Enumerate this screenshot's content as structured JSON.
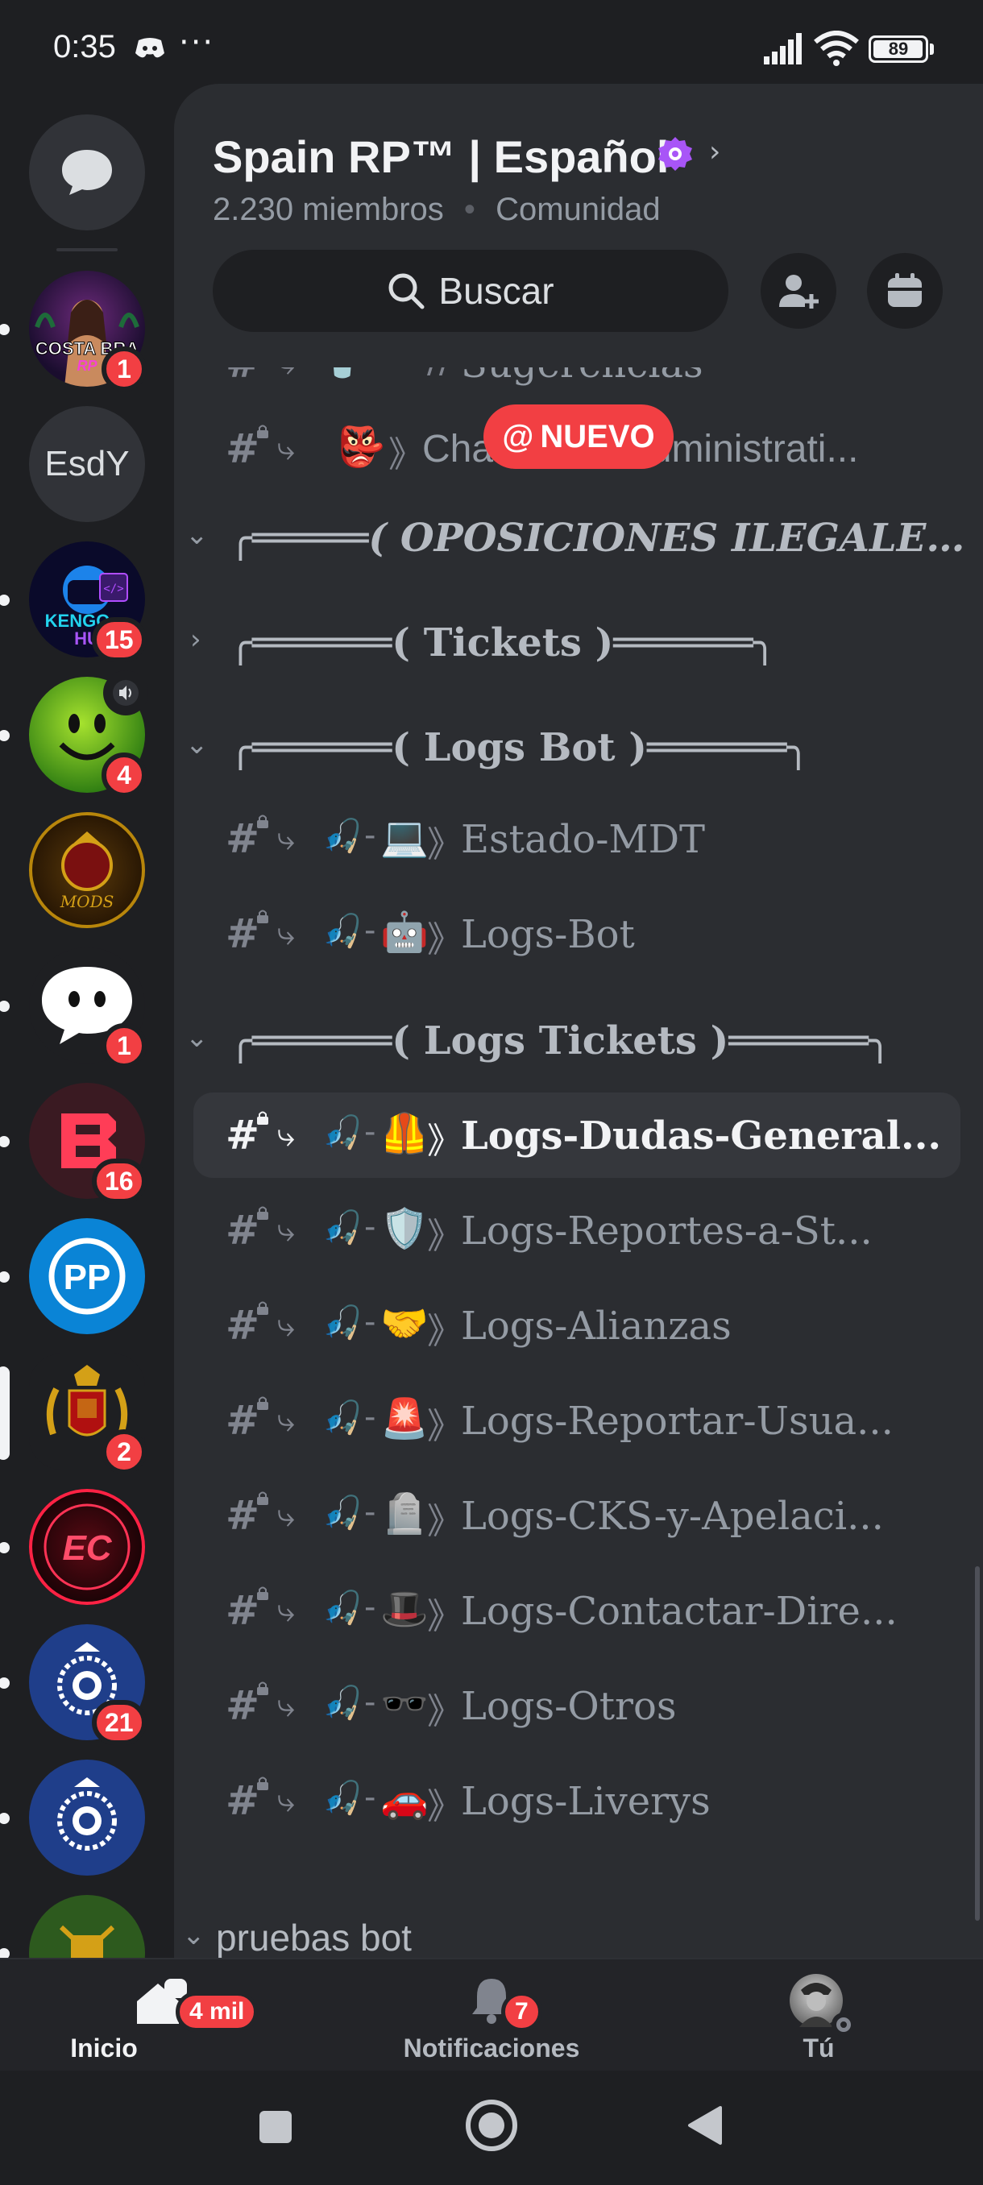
{
  "status_bar": {
    "time": "0:35",
    "more": "···",
    "battery": "89",
    "battery_level_pct": 89
  },
  "server": {
    "name": "Spain RP™ | Español",
    "members": "2.230 miembros",
    "separator": "•",
    "type": "Comunidad",
    "search_label": "Buscar"
  },
  "rail": {
    "servers": [
      {
        "name": "COSTA BRAVA",
        "badge": "1"
      },
      {
        "name": "EsdY",
        "badge": ""
      },
      {
        "name": "KENGO HUB",
        "badge": "15"
      },
      {
        "name": "Smiley server",
        "badge": "4"
      },
      {
        "name": "MODS",
        "badge": ""
      },
      {
        "name": "Chat server",
        "badge": "1"
      },
      {
        "name": "EB server",
        "badge": "16"
      },
      {
        "name": "PP",
        "badge": ""
      },
      {
        "name": "Escudo server",
        "badge": "2"
      },
      {
        "name": "EC server",
        "badge": ""
      },
      {
        "name": "Policía server 1",
        "badge": "21"
      },
      {
        "name": "Policía server 2",
        "badge": ""
      },
      {
        "name": "Guardia server",
        "badge": ""
      }
    ],
    "avatar_texts": {
      "costa": "COSTA BRA",
      "costa_sub": "RP",
      "esdy": "EsdY",
      "kengo": "KENGO",
      "kengo_sub": "HU",
      "mods": "MODS",
      "pp": "PP",
      "ec": "EC"
    }
  },
  "new_pill": {
    "at": "@",
    "label": "NUEVO"
  },
  "channels": {
    "partial_top": {
      "name": "Sugerencias"
    },
    "chat_mafia": {
      "prefix": "⤷",
      "emoji": "👺",
      "sep": "》",
      "name": "Chat-Mafia-Administrati..."
    },
    "cat_oposiciones": {
      "name": "╭═════( OPOSICIONES ILEGALES )═...",
      "chevron": "⌄"
    },
    "cat_tickets": {
      "name": "╭══════( Tickets )══════╮",
      "chevron": "›"
    },
    "cat_logsbot": {
      "name": "╭══════( Logs Bot )══════╮",
      "chevron": "⌄"
    },
    "logsbot_items": [
      {
        "emoji": "💻",
        "name": "Estado-MDT"
      },
      {
        "emoji": "🤖",
        "name": "Logs-Bot"
      }
    ],
    "cat_logstickets": {
      "name": "╭══════( Logs Tickets )══════╮",
      "chevron": "⌄"
    },
    "logstickets_items": [
      {
        "emoji": "🦺",
        "name": "Logs-Dudas-General...",
        "active": true
      },
      {
        "emoji": "🛡️",
        "name": "Logs-Reportes-a-St..."
      },
      {
        "emoji": "🤝",
        "name": "Logs-Alianzas"
      },
      {
        "emoji": "🚨",
        "name": "Logs-Reportar-Usua..."
      },
      {
        "emoji": "🪦",
        "name": "Logs-CKS-y-Apelaci..."
      },
      {
        "emoji": "🎩",
        "name": "Logs-Contactar-Dire..."
      },
      {
        "emoji": "🕶️",
        "name": "Logs-Otros"
      },
      {
        "emoji": "🚗",
        "name": "Logs-Liverys"
      }
    ],
    "cat_pruebas": {
      "name": "pruebas bot",
      "chevron": "⌄"
    },
    "row_prefix": {
      "hash": "#",
      "arrow": "⤷",
      "fish": "🎣",
      "dash": "-",
      "sep": "》"
    }
  },
  "bottom_nav": {
    "home": {
      "label": "Inicio",
      "badge": "4 mil"
    },
    "notifications": {
      "label": "Notificaciones",
      "badge": "7"
    },
    "you": {
      "label": "Tú"
    }
  },
  "colors": {
    "accent_red": "#f23f43",
    "bg_dark": "#1e1f22",
    "panel": "#2b2d31",
    "verified": "#a855f7"
  }
}
